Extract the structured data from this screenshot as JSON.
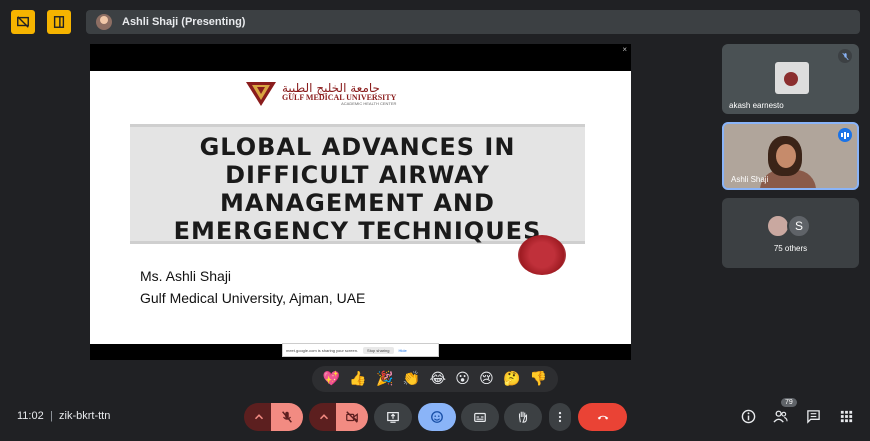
{
  "top_icons": [
    "presentation-off-icon",
    "tablet-icon"
  ],
  "presenting": {
    "label": "Ashli Shaji (Presenting)"
  },
  "slide": {
    "close_glyph": "×",
    "logo_arabic": "جامعة الخليج الطبية",
    "logo_english": "GULF MEDICAL UNIVERSITY",
    "logo_sub": "ACADEMIC HEALTH CENTER",
    "title_lines": [
      "GLOBAL ADVANCES IN",
      "DIFFICULT AIRWAY",
      "MANAGEMENT AND",
      "EMERGENCY TECHNIQUES"
    ],
    "author_name": "Ms. Ashli Shaji",
    "author_affiliation": "Gulf Medical University, Ajman, UAE",
    "share_notice": "meet.google.com is sharing your screen.",
    "stop_sharing": "Stop sharing",
    "hide": "Hide"
  },
  "participants": [
    {
      "name": "akash earnesto",
      "muted": true
    },
    {
      "name": "Ashli Shaji",
      "speaking": true
    },
    {
      "label": "75 others",
      "avatar_letter": "S"
    }
  ],
  "reactions": [
    "💖",
    "👍",
    "🎉",
    "👏",
    "😂",
    "😮",
    "😢",
    "🤔",
    "👎"
  ],
  "meeting": {
    "time": "11:02",
    "separator": "|",
    "code": "zik-bkrt-ttn"
  },
  "controls": {
    "participants_count": "79"
  },
  "colors": {
    "accent_yellow": "#f6b400",
    "end_call": "#ea4335",
    "active_blue": "#8ab4f8",
    "mute_red": "#f28b82"
  }
}
